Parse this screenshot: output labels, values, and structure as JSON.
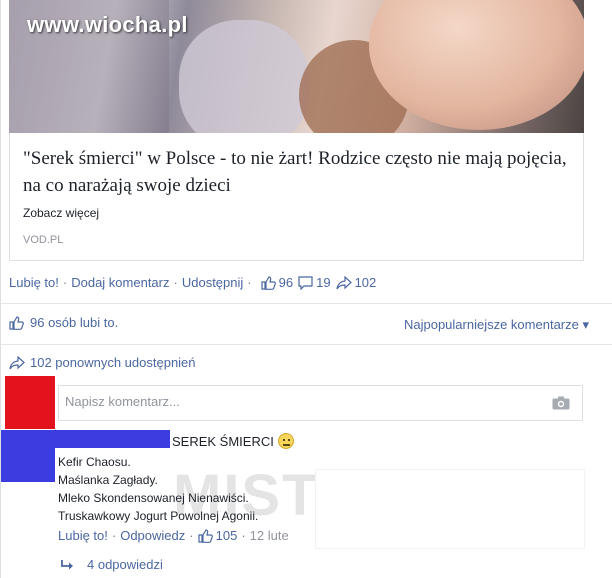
{
  "watermark": "www.wiocha.pl",
  "preview": {
    "title": "\"Serek śmierci\" w Polsce - to nie żart! Rodzice często nie mają pojęcia, na co narażają swoje dzieci",
    "description": "Zobacz więcej",
    "domain": "VOD.PL"
  },
  "actions": {
    "like": "Lubię to!",
    "comment": "Dodaj komentarz",
    "share": "Udostępnij",
    "like_count": "96",
    "comment_count": "19",
    "share_count": "102"
  },
  "likes_row": {
    "text": "96 osób lubi to.",
    "sort_label": "Najpopularniejsze komentarze ▾"
  },
  "shares_row": {
    "text": "102 ponownych udostępnień"
  },
  "composer": {
    "placeholder": "Napisz komentarz..."
  },
  "comment": {
    "title": "SEREK ŚMIERCI",
    "lines": [
      "Kefir Chaosu.",
      "Maślanka Zagłady.",
      "Mleko Skondensowanej Nienawiści.",
      "Truskawkowy Jogurt Powolnej Agonii."
    ],
    "ghost": "MISTR",
    "like": "Lubię to!",
    "reply": "Odpowiedz",
    "like_count": "105",
    "date": "12 lute"
  },
  "replies": {
    "label": "4 odpowiedzi"
  },
  "colors": {
    "link": "#4b67a1",
    "avatar_red": "#e3131e",
    "avatar_blue": "#3b3de0"
  }
}
